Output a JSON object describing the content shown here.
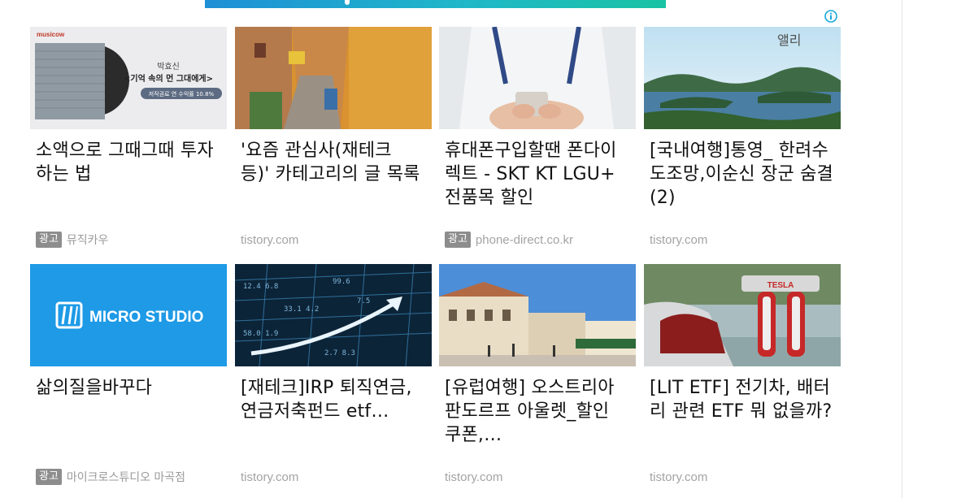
{
  "cards": [
    {
      "title": "소액으로 그때그때 투자하는 법",
      "ad_badge": "광고",
      "source": "뮤직카우",
      "thumb": {
        "brand": "musicow",
        "album_artist": "박효신",
        "album_title": "<기억 속의 먼 그대에게>",
        "album_note": "저작권료 연 수익률 10.8%"
      }
    },
    {
      "title": "'요즘 관심사(재테크 등)' 카테고리의 글 목록",
      "source": "tistory.com"
    },
    {
      "title": "휴대폰구입할땐 폰다이렉트 - SKT KT LGU+ 전품목 할인",
      "ad_badge": "광고",
      "source": "phone-direct.co.kr"
    },
    {
      "title": "[국내여행]통영_ 한려수도조망,이순신 장군 숨결(2)",
      "source": "tistory.com",
      "thumb": {
        "watermark": "앨리"
      }
    },
    {
      "title": "삶의질을바꾸다",
      "ad_badge": "광고",
      "source": "마이크로스튜디오 마곡점",
      "thumb": {
        "logo_text": "MICRO STUDIO",
        "bg": "#1e9ae6"
      }
    },
    {
      "title": "[재테크]IRP 퇴직연금, 연금저축펀드 etf…",
      "source": "tistory.com"
    },
    {
      "title": "[유럽여행] 오스트리아 판도르프 아울렛_할인 쿠폰,…",
      "source": "tistory.com"
    },
    {
      "title": "[LIT ETF] 전기차, 배터리 관련 ETF 뭐 없을까?",
      "source": "tistory.com",
      "thumb": {
        "sign_text": "TESLA"
      }
    }
  ],
  "colors": {
    "banner": "#1fb0cf",
    "info_icon": "#18a9d8",
    "ad_badge_bg": "#8d8d8d",
    "title": "#111111",
    "source": "#9a9a9a"
  },
  "icons": {
    "info": "info-circle-icon"
  }
}
